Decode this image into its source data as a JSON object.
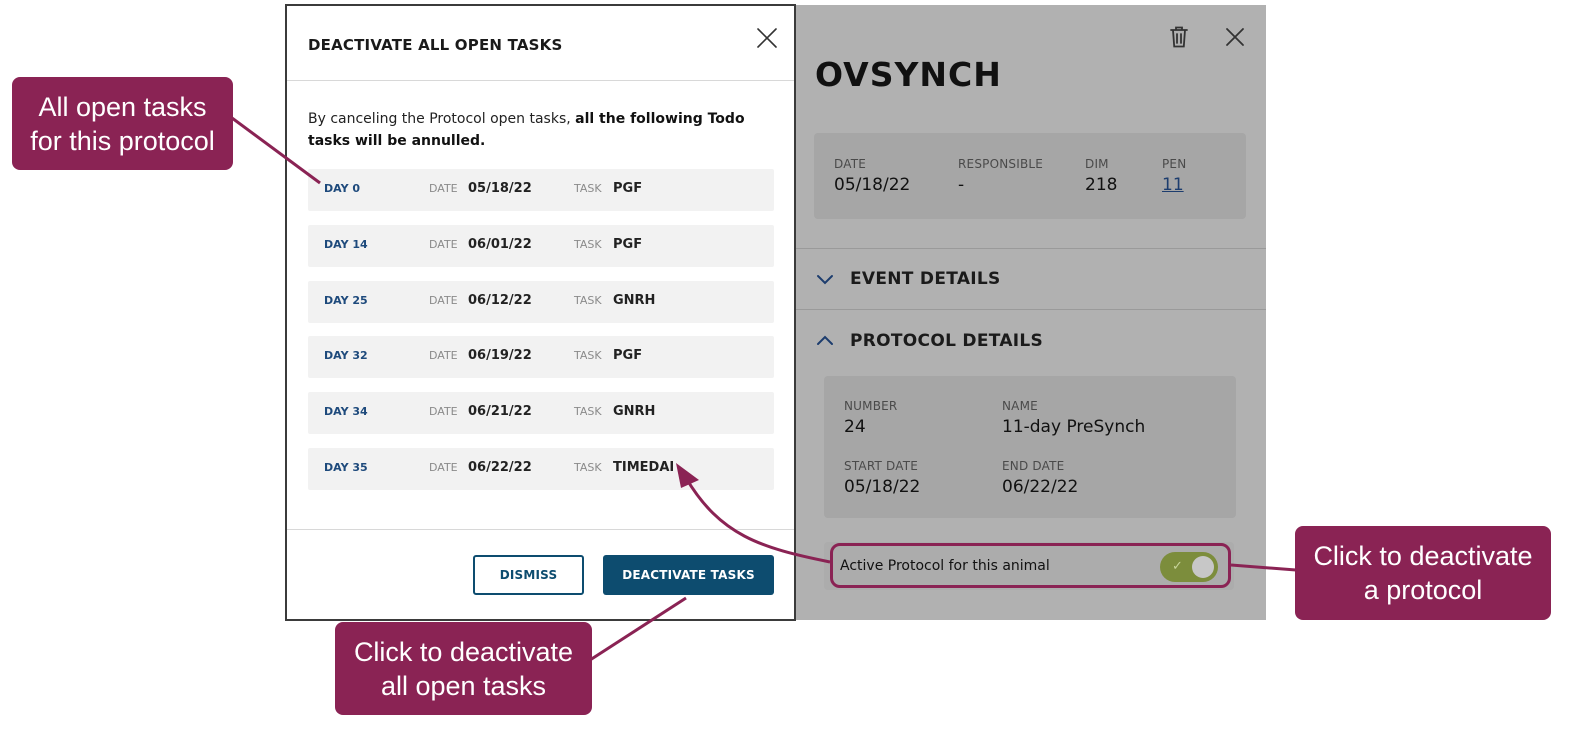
{
  "panel": {
    "title": "OVSYNCH",
    "summary": [
      {
        "label": "DATE",
        "value": "05/18/22"
      },
      {
        "label": "RESPONSIBLE",
        "value": "-"
      },
      {
        "label": "DIM",
        "value": "218"
      },
      {
        "label": "PEN",
        "value": "11"
      }
    ],
    "event_details_label": "EVENT DETAILS",
    "protocol_details_label": "PROTOCOL DETAILS",
    "protocol": {
      "number_label": "NUMBER",
      "number": "24",
      "name_label": "NAME",
      "name": "11-day PreSynch",
      "start_label": "START DATE",
      "start": "05/18/22",
      "end_label": "END DATE",
      "end": "06/22/22"
    },
    "active_protocol_label": "Active Protocol for this animal",
    "active_protocol_on": true
  },
  "modal": {
    "title": "DEACTIVATE ALL OPEN TASKS",
    "body_plain": "By canceling the Protocol open tasks, ",
    "body_bold": "all the following Todo tasks will be annulled.",
    "date_label": "DATE",
    "task_label": "TASK",
    "tasks": [
      {
        "day": "DAY 0",
        "date": "05/18/22",
        "task": "PGF"
      },
      {
        "day": "DAY 14",
        "date": "06/01/22",
        "task": "PGF"
      },
      {
        "day": "DAY 25",
        "date": "06/12/22",
        "task": "GNRH"
      },
      {
        "day": "DAY 32",
        "date": "06/19/22",
        "task": "PGF"
      },
      {
        "day": "DAY 34",
        "date": "06/21/22",
        "task": "GNRH"
      },
      {
        "day": "DAY 35",
        "date": "06/22/22",
        "task": "TIMEDAI"
      }
    ],
    "dismiss_label": "DISMISS",
    "deactivate_label": "DEACTIVATE TASKS"
  },
  "callouts": {
    "open_tasks": [
      "All open tasks",
      "for this protocol"
    ],
    "deactivate_all": [
      "Click to deactivate",
      "all open tasks"
    ],
    "deactivate_protocol": [
      "Click to deactivate",
      "a protocol"
    ]
  },
  "colors": {
    "accent": "#0d4c6f",
    "callout": "#8a2354",
    "toggle_on": "#7c8d3c"
  }
}
